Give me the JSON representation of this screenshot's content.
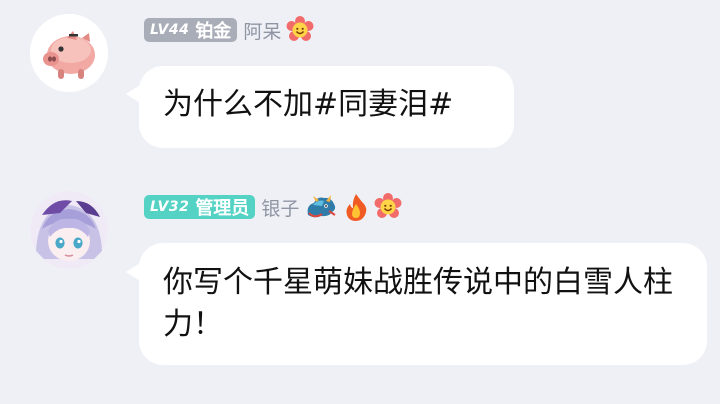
{
  "messages": [
    {
      "level": "LV44",
      "rank": "铂金",
      "username": "阿呆",
      "badge_color": "#a9adb8",
      "text": "为什么不加#同妻泪#",
      "decorations": [
        "flower-face-icon"
      ],
      "avatar": "pig-avatar-icon"
    },
    {
      "level": "LV32",
      "rank": "管理员",
      "username": "银子",
      "badge_color": "#54d2c4",
      "text": "你写个千星萌妹战胜传说中的白雪人柱力！",
      "decorations": [
        "dragon-icon",
        "fire-icon",
        "flower-face-icon"
      ],
      "avatar": "anime-girl-avatar-icon"
    }
  ]
}
